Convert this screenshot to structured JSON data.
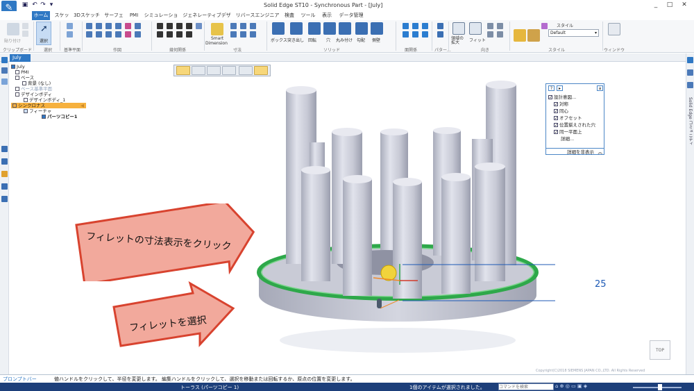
{
  "titlebar": {
    "title": "Solid Edge ST10 - Synchronous Part - [July]",
    "quick_access": [
      "save-icon",
      "undo-icon",
      "redo-icon",
      "dropdown-icon"
    ],
    "window_controls": [
      "_",
      "□",
      "✕"
    ]
  },
  "menu_tabs": [
    "ホーム",
    "スケッチ",
    "3Dスケッチ",
    "サーフェス",
    "PMI",
    "シミュレーション",
    "ジェネレーティブデザイン",
    "リバースエンジニアリング",
    "検査",
    "ツール",
    "表示",
    "データ管理"
  ],
  "active_tab": "ホーム",
  "ribbon": {
    "groups": [
      "クリップボード",
      "選択",
      "基準平面",
      "作図",
      "幾何関係",
      "寸法",
      "ソリッド",
      "面関係",
      "パター...",
      "向き",
      "スタイル",
      "ウィンドウ"
    ],
    "clipboard_label": "貼り付け",
    "select_label": "選択",
    "smart_dimension": [
      "Smart",
      "Dimension"
    ],
    "solid_buttons": [
      "ボックス",
      "突き出し",
      "回転",
      "穴",
      "丸み付け",
      "勾配",
      "側壁"
    ],
    "view_buttons": [
      "領域の拡大",
      "フィット"
    ],
    "style_label": "スタイル",
    "style_value": "Default"
  },
  "document_tab": "July",
  "tree": {
    "root": "July",
    "items": [
      "PMI",
      "ベース",
      "背景 (なし)",
      "ベース基準平面",
      "デザインボディ",
      "デザインボディ_1",
      "シンクロナス",
      "フィーチャ",
      "パーツコピー1"
    ]
  },
  "intent_panel": {
    "title": "設計意図...",
    "options": [
      "対称",
      "同心",
      "オフセット",
      "位置揃えされた穴",
      "同一平面上"
    ],
    "detail_link": "詳細...",
    "hide_button": "詳細を非表示"
  },
  "dimension": {
    "value": "25"
  },
  "callouts": {
    "top": "フィレットの寸法表示をクリック",
    "bottom": "フィレットを選択"
  },
  "viewcube_label": "TOP",
  "copyright": "Copyright(C)2018 SIEMENS JAPAN CO.,LTD. All Rights Reserved",
  "prompt_bar": {
    "label": "プロンプトバー",
    "text": "値ハンドルをクリックして、半径を変更します。 編集ハンドルをクリックして、選択を移動または回転するか、原点の位置を変更します。"
  },
  "status": {
    "selection": "トーラス (パーツコピー 1)",
    "count_text": "1個のアイテムが選択されました。",
    "command_search_placeholder": "コマンドを検索"
  },
  "right_sidebar_label": "Solid Edge コミュニティ",
  "colors": {
    "accent": "#2f78c4",
    "fillet_green": "#2ea84a",
    "callout_red": "#e0513d",
    "callout_fill": "#f2a99c",
    "status_bg": "#1d3f7a"
  }
}
